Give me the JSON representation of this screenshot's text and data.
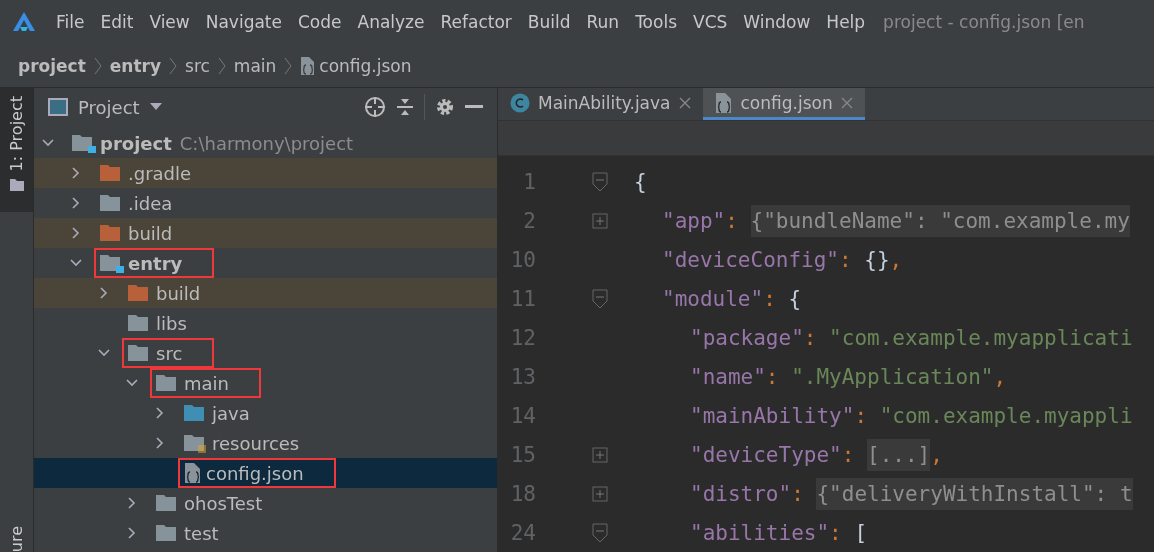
{
  "menu_bar": {
    "items": [
      "File",
      "Edit",
      "View",
      "Navigate",
      "Code",
      "Analyze",
      "Refactor",
      "Build",
      "Run",
      "Tools",
      "VCS",
      "Window",
      "Help"
    ],
    "title": "project - config.json [en"
  },
  "breadcrumbs": [
    {
      "label": "project",
      "bold": true,
      "kind": "folder"
    },
    {
      "label": "entry",
      "bold": true,
      "kind": "folder"
    },
    {
      "label": "src",
      "bold": false,
      "kind": "folder"
    },
    {
      "label": "main",
      "bold": false,
      "kind": "folder"
    },
    {
      "label": "config.json",
      "bold": false,
      "kind": "json"
    }
  ],
  "side_stripe": {
    "top": "1: Project",
    "bottom": "ure"
  },
  "project_panel": {
    "title": "Project",
    "tree": [
      {
        "label": "project",
        "hint": "C:\\harmony\\project",
        "kind": "module",
        "bold": true,
        "expanded": true,
        "excluded": false,
        "selected": false,
        "highlighted": false,
        "children": [
          {
            "label": ".gradle",
            "kind": "excluded_folder",
            "bold": false,
            "expanded": false,
            "excluded": true,
            "selected": false,
            "highlighted": false
          },
          {
            "label": ".idea",
            "kind": "folder",
            "bold": false,
            "expanded": false,
            "excluded": false,
            "selected": false,
            "highlighted": false
          },
          {
            "label": "build",
            "kind": "excluded_folder",
            "bold": false,
            "expanded": false,
            "excluded": true,
            "selected": false,
            "highlighted": false
          },
          {
            "label": "entry",
            "kind": "module",
            "bold": true,
            "expanded": true,
            "excluded": false,
            "selected": false,
            "highlighted": true,
            "children": [
              {
                "label": "build",
                "kind": "excluded_folder",
                "bold": false,
                "expanded": false,
                "excluded": true,
                "selected": false,
                "highlighted": false
              },
              {
                "label": "libs",
                "kind": "folder",
                "bold": false,
                "excluded": false,
                "selected": false,
                "highlighted": false
              },
              {
                "label": "src",
                "kind": "folder",
                "bold": false,
                "expanded": true,
                "excluded": false,
                "selected": false,
                "highlighted": true,
                "children": [
                  {
                    "label": "main",
                    "kind": "folder",
                    "bold": false,
                    "expanded": true,
                    "excluded": false,
                    "selected": false,
                    "highlighted": true,
                    "children": [
                      {
                        "label": "java",
                        "kind": "source_folder",
                        "bold": false,
                        "expanded": false,
                        "excluded": false,
                        "selected": false,
                        "highlighted": false
                      },
                      {
                        "label": "resources",
                        "kind": "resources_folder",
                        "bold": false,
                        "expanded": false,
                        "excluded": false,
                        "selected": false,
                        "highlighted": false
                      },
                      {
                        "label": "config.json",
                        "kind": "json",
                        "bold": false,
                        "excluded": false,
                        "selected": true,
                        "highlighted": true
                      }
                    ]
                  },
                  {
                    "label": "ohosTest",
                    "kind": "folder",
                    "bold": false,
                    "expanded": false,
                    "excluded": false,
                    "selected": false,
                    "highlighted": false
                  },
                  {
                    "label": "test",
                    "kind": "folder",
                    "bold": false,
                    "expanded": false,
                    "excluded": false,
                    "selected": false,
                    "highlighted": false
                  }
                ]
              }
            ]
          }
        ]
      }
    ]
  },
  "editor": {
    "tabs": [
      {
        "label": "MainAbility.java",
        "kind": "class",
        "selected": false
      },
      {
        "label": "config.json",
        "kind": "json",
        "selected": true
      }
    ],
    "lines": [
      {
        "number": "1",
        "kind": "fold_open",
        "tokens": [
          {
            "kind": "brace",
            "text": "{"
          }
        ],
        "children": [
          {
            "number": "2",
            "kind": "fold_closed",
            "tokens": [
              {
                "kind": "key",
                "text": "\"app\""
              },
              {
                "kind": "punct",
                "text": ": "
              },
              {
                "kind": "folded",
                "text": "{\"bundleName\": \"com.example.my"
              }
            ]
          },
          {
            "number": "10",
            "kind": "plain",
            "tokens": [
              {
                "kind": "key",
                "text": "\"deviceConfig\""
              },
              {
                "kind": "punct",
                "text": ": "
              },
              {
                "kind": "brace",
                "text": "{}"
              },
              {
                "kind": "punct",
                "text": ","
              }
            ]
          },
          {
            "number": "11",
            "kind": "fold_open",
            "tokens": [
              {
                "kind": "key",
                "text": "\"module\""
              },
              {
                "kind": "punct",
                "text": ": "
              },
              {
                "kind": "brace",
                "text": "{"
              }
            ],
            "children": [
              {
                "number": "12",
                "kind": "plain",
                "tokens": [
                  {
                    "kind": "key",
                    "text": "\"package\""
                  },
                  {
                    "kind": "punct",
                    "text": ": "
                  },
                  {
                    "kind": "string",
                    "text": "\"com.example.myapplicati"
                  }
                ]
              },
              {
                "number": "13",
                "kind": "plain",
                "tokens": [
                  {
                    "kind": "key",
                    "text": "\"name\""
                  },
                  {
                    "kind": "punct",
                    "text": ": "
                  },
                  {
                    "kind": "string",
                    "text": "\".MyApplication\""
                  },
                  {
                    "kind": "punct",
                    "text": ","
                  }
                ]
              },
              {
                "number": "14",
                "kind": "plain",
                "tokens": [
                  {
                    "kind": "key",
                    "text": "\"mainAbility\""
                  },
                  {
                    "kind": "punct",
                    "text": ": "
                  },
                  {
                    "kind": "string",
                    "text": "\"com.example.myappli"
                  }
                ]
              },
              {
                "number": "15",
                "kind": "fold_closed",
                "tokens": [
                  {
                    "kind": "key",
                    "text": "\"deviceType\""
                  },
                  {
                    "kind": "punct",
                    "text": ": "
                  },
                  {
                    "kind": "folded",
                    "text": "[...]"
                  },
                  {
                    "kind": "punct",
                    "text": ","
                  }
                ]
              },
              {
                "number": "18",
                "kind": "fold_closed",
                "tokens": [
                  {
                    "kind": "key",
                    "text": "\"distro\""
                  },
                  {
                    "kind": "punct",
                    "text": ": "
                  },
                  {
                    "kind": "folded",
                    "text": "{\"deliveryWithInstall\": t"
                  }
                ]
              },
              {
                "number": "24",
                "kind": "fold_open",
                "tokens": [
                  {
                    "kind": "key",
                    "text": "\"abilities\""
                  },
                  {
                    "kind": "punct",
                    "text": ": "
                  },
                  {
                    "kind": "brace",
                    "text": "["
                  }
                ]
              }
            ]
          }
        ]
      }
    ]
  }
}
